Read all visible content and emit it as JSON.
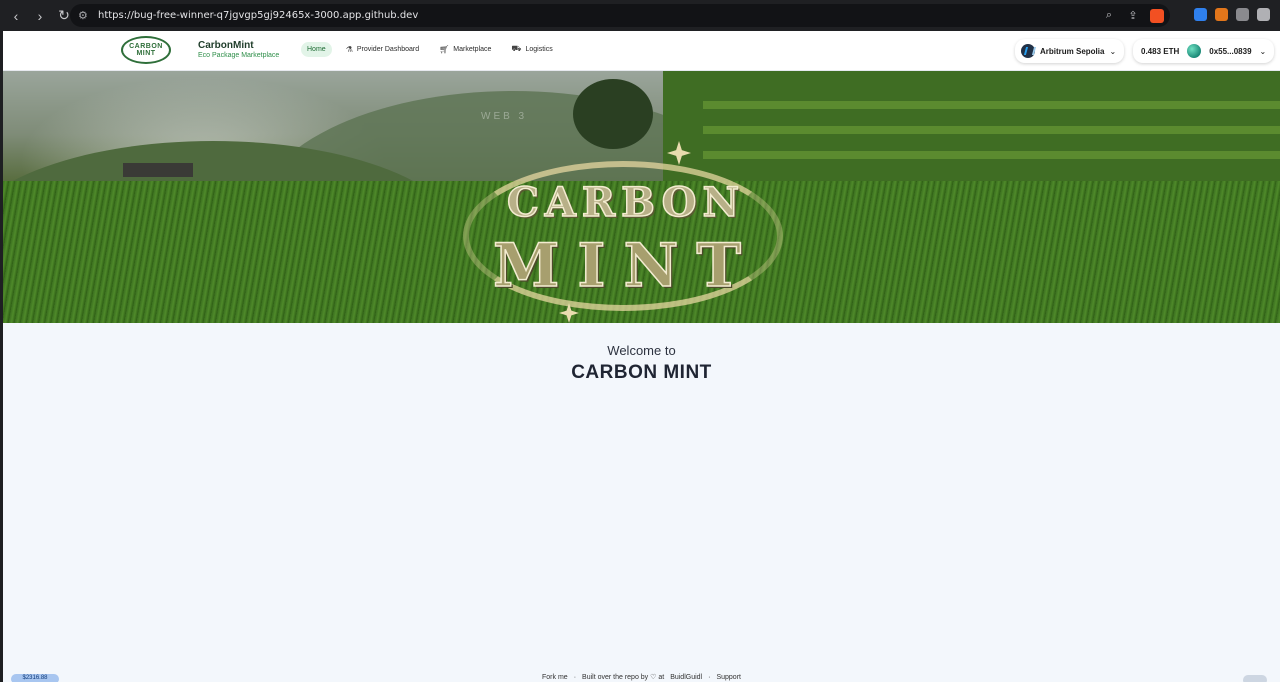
{
  "browser": {
    "url": "https://bug-free-winner-q7jgvgp5gj92465x-3000.app.github.dev"
  },
  "header": {
    "logo_text": "CARBON MINT",
    "brand_name": "CarbonMint",
    "brand_tagline": "Eco Package Marketplace",
    "nav": [
      {
        "label": "Home",
        "icon": "",
        "active": true
      },
      {
        "label": "Provider Dashboard",
        "icon": "flask-icon",
        "active": false
      },
      {
        "label": "Marketplace",
        "icon": "cart-icon",
        "active": false
      },
      {
        "label": "Logistics",
        "icon": "truck-icon",
        "active": false
      }
    ],
    "network": "Arbitrum Sepolia",
    "balance": "0.483 ETH",
    "address": "0x55...0839"
  },
  "hero": {
    "watermark": "WEB 3",
    "emblem_line1": "CARBON",
    "emblem_line2": "MINT"
  },
  "main": {
    "welcome_pre": "Welcome to",
    "welcome_title": "CARBON MINT"
  },
  "footer": {
    "price": "$2316.88",
    "items": [
      "Fork me",
      "·",
      "Built over the repo by ♡ at",
      "BuidlGuidl",
      "·",
      "Support"
    ]
  }
}
